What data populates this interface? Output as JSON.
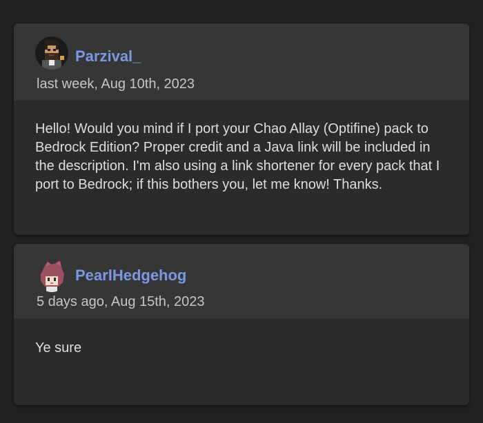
{
  "comments": [
    {
      "author": "Parzival_",
      "date": "last week, Aug 10th, 2023",
      "message": "Hello! Would you mind if I port your Chao Allay (Optifine) pack to Bedrock Edition? Proper credit and a Java link will be included in the description. I'm also using a link shortener for every pack that I port to Bedrock; if this bothers you, let me know! Thanks.",
      "avatar_icon": "bearded-man-pixel-avatar"
    },
    {
      "author": "PearlHedgehog",
      "date": "5 days ago, Aug 15th, 2023",
      "message": "Ye sure",
      "avatar_icon": "pink-hedgehog-pixel-avatar"
    }
  ],
  "colors": {
    "background": "#212121",
    "card_header": "#363636",
    "card_body": "#2b2b2b",
    "username": "#7b98e3",
    "timestamp": "#c6c6c6",
    "message_text": "#dedede"
  }
}
